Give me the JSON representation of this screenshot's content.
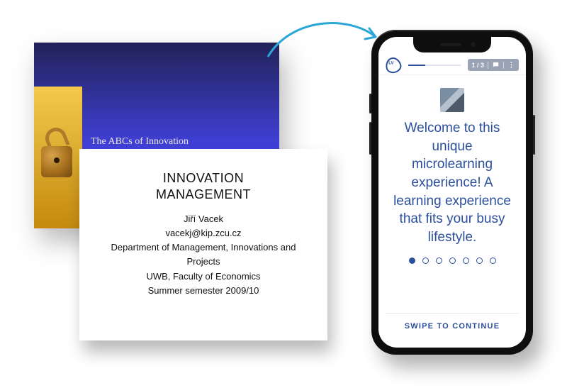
{
  "slides": {
    "back_title": "The ABCs of Innovation",
    "front": {
      "title_line1": "INNOVATION",
      "title_line2": "MANAGEMENT",
      "author": "Jiří Vacek",
      "email": "vacekj@kip.zcu.cz",
      "department": "Department of Management, Innovations and Projects",
      "institution": "UWB, Faculty of Economics",
      "term": "Summer semester 2009/10"
    }
  },
  "phone": {
    "page_indicator": "1 / 3",
    "welcome_text": "Welcome to this unique microlearning experience! A learning experience that fits your busy lifestyle.",
    "swipe_label": "SWIPE TO CONTINUE",
    "dot_count": 7,
    "active_dot": 0
  },
  "colors": {
    "brand_blue": "#2b4f9b"
  }
}
